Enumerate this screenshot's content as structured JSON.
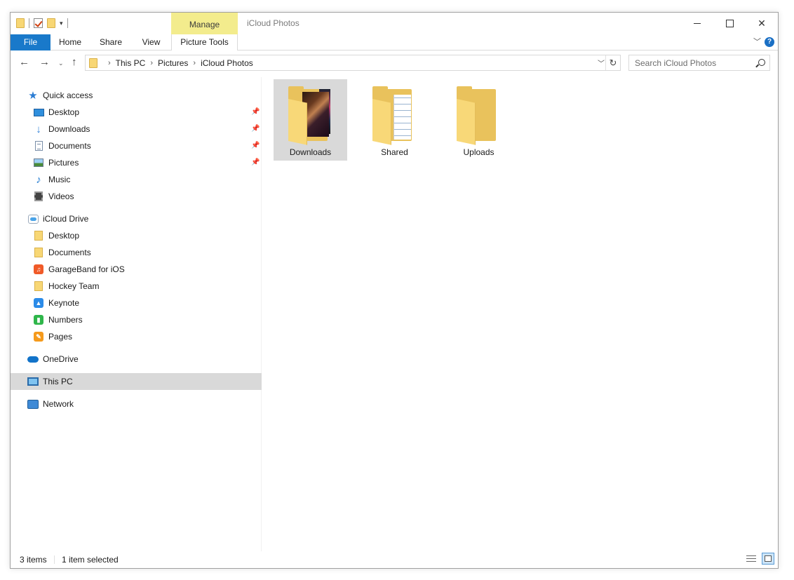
{
  "window": {
    "title": "iCloud Photos",
    "contextual_tab_group": "Manage"
  },
  "ribbon": {
    "tabs": [
      "File",
      "Home",
      "Share",
      "View",
      "Picture Tools"
    ]
  },
  "address": {
    "breadcrumbs": [
      "This PC",
      "Pictures",
      "iCloud Photos"
    ]
  },
  "search": {
    "placeholder": "Search iCloud Photos"
  },
  "nav": {
    "quick_access": {
      "label": "Quick access",
      "items": [
        "Desktop",
        "Downloads",
        "Documents",
        "Pictures",
        "Music",
        "Videos"
      ]
    },
    "icloud": {
      "label": "iCloud Drive",
      "items": [
        "Desktop",
        "Documents",
        "GarageBand for iOS",
        "Hockey Team",
        "Keynote",
        "Numbers",
        "Pages"
      ]
    },
    "onedrive": "OneDrive",
    "this_pc": "This PC",
    "network": "Network"
  },
  "content": {
    "items": [
      {
        "name": "Downloads",
        "selected": true
      },
      {
        "name": "Shared",
        "selected": false
      },
      {
        "name": "Uploads",
        "selected": false
      }
    ]
  },
  "status": {
    "count": "3 items",
    "selection": "1 item selected"
  },
  "colors": {
    "accent": "#1979ca",
    "manage_tab": "#f3ec8d",
    "selection": "#d9d9d9",
    "folder": "#f8d775"
  }
}
